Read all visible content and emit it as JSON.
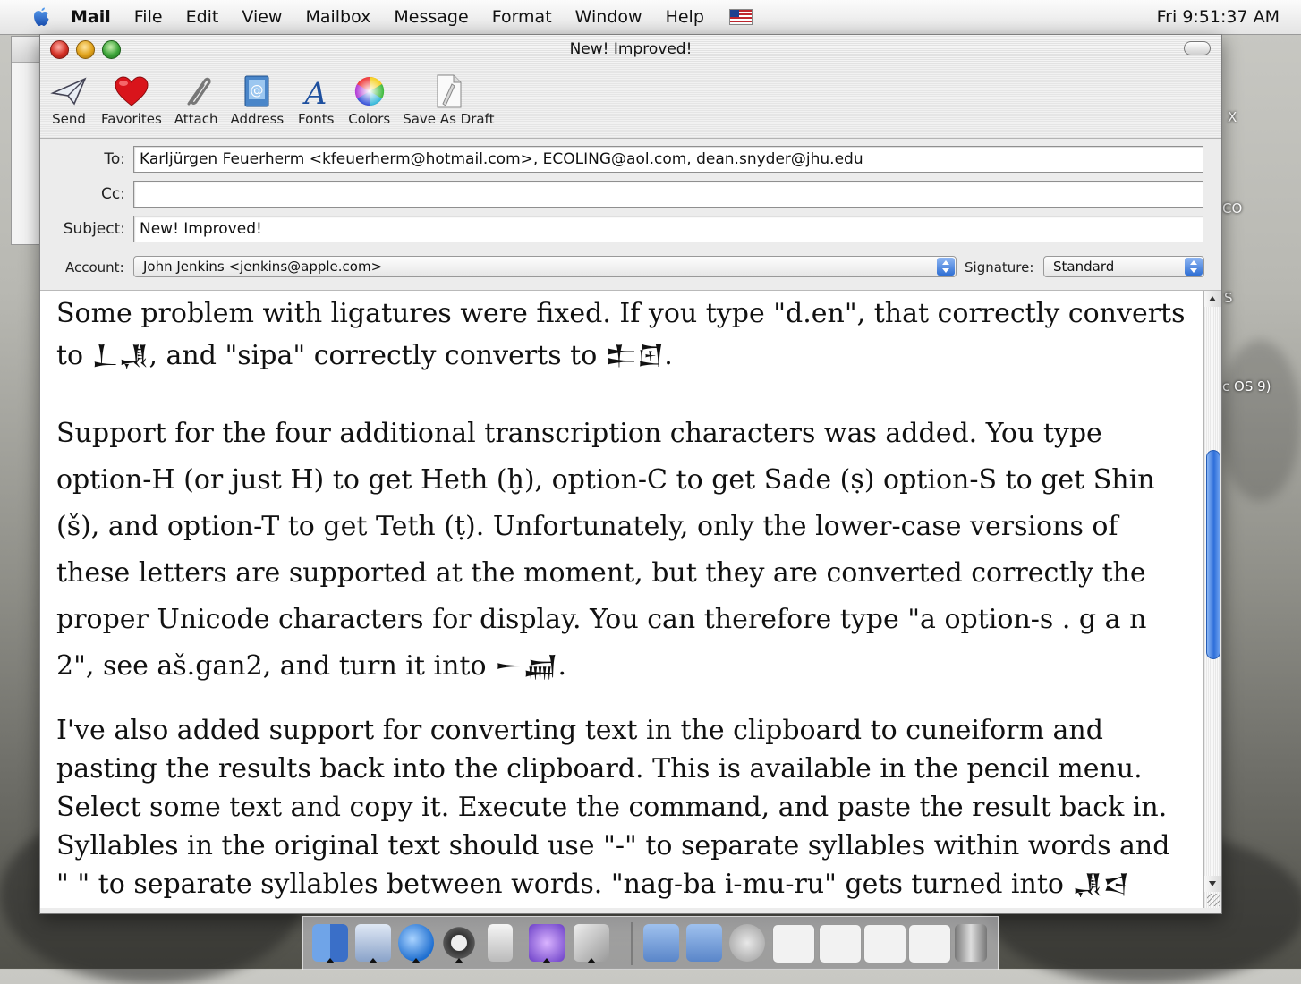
{
  "menubar": {
    "items": [
      "Mail",
      "File",
      "Edit",
      "View",
      "Mailbox",
      "Message",
      "Format",
      "Window",
      "Help"
    ],
    "clock": "Fri 9:51:37 AM"
  },
  "window": {
    "title": "New! Improved!"
  },
  "toolbar": {
    "items": [
      {
        "label": "Send",
        "icon": "send-icon"
      },
      {
        "label": "Favorites",
        "icon": "heart-icon"
      },
      {
        "label": "Attach",
        "icon": "paperclip-icon"
      },
      {
        "label": "Address",
        "icon": "address-book-icon"
      },
      {
        "label": "Fonts",
        "icon": "font-icon"
      },
      {
        "label": "Colors",
        "icon": "color-wheel-icon"
      },
      {
        "label": "Save As Draft",
        "icon": "draft-icon"
      }
    ]
  },
  "headers": {
    "to_label": "To:",
    "to_value": "Karljürgen Feuerherm <kfeuerherm@hotmail.com>, ECOLING@aol.com, dean.snyder@jhu.edu",
    "cc_label": "Cc:",
    "cc_value": "",
    "subject_label": "Subject:",
    "subject_value": "New! Improved!",
    "account_label": "Account:",
    "account_value": "John Jenkins <jenkins@apple.com>",
    "signature_label": "Signature:",
    "signature_value": "Standard"
  },
  "body": {
    "p1": "Some problem with ligatures were fixed.  If you type \"d.en\", that correctly converts to 𒁇𒂗, and \"sipa\" correctly converts to 𒉺𒇻.",
    "p2": "Support for the four additional transcription characters was added.  You type option-H (or just H) to get Heth (ḫ), option-C to get Sade (ṣ) option-S to get Shin (š), and option-T to get Teth (ṭ).  Unfortunately, only the lower-case versions of these letters are supported at the moment, but they are converted correctly the proper Unicode characters for display.  You can therefore type \"a option-s . g a n 2\", see aš.gan2, and turn it into 𒀸𒃷.",
    "p3": "I've also added support for converting text in the clipboard to cuneiform and pasting the results back into the clipboard.  This is available in the pencil menu.  Select some text and copy it.  Execute the command, and paste the result back in.  Syllables in the original text should use \"-\" to separate syllables within words and \" \" to separate syllables between words.  \"nag-ba i-mu-ru\" gets turned into 𒂗𒁀 𒄿𒈬𒊒.  This feature currently"
  },
  "desktop": {
    "labels": [
      "X",
      "CO",
      "S",
      "c OS 9)"
    ]
  },
  "dock": {
    "icons": [
      "finder-icon",
      "mail-icon",
      "internet-explorer-icon",
      "sherlock-icon",
      "battery-icon",
      "itunes-icon",
      "preview-icon",
      "applications-folder-icon",
      "documents-folder-icon",
      "email-at-icon",
      "window-thumbnail-icon",
      "window-thumbnail-icon",
      "window-thumbnail-icon",
      "window-thumbnail-icon",
      "trash-icon"
    ]
  }
}
